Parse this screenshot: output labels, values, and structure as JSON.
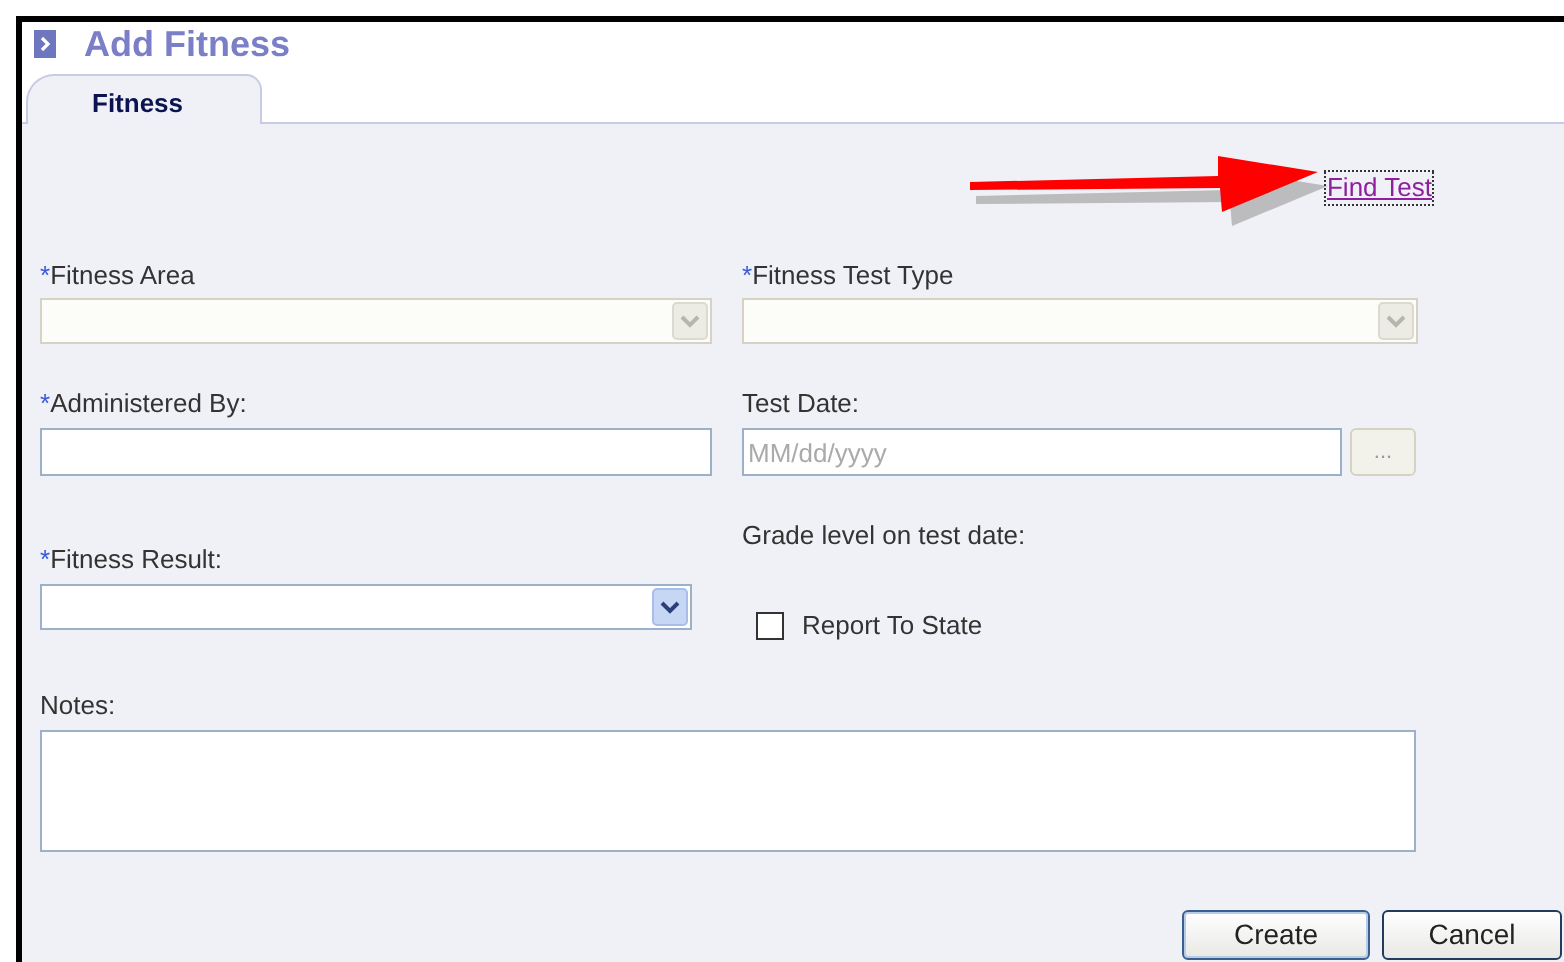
{
  "window": {
    "title": "Add Fitness"
  },
  "tabs": [
    {
      "label": "Fitness",
      "selected": true
    }
  ],
  "find_link": "Find Test",
  "fields": {
    "fitness_area": {
      "required_mark": "*",
      "label": "Fitness Area",
      "disabled": true
    },
    "fitness_test_type": {
      "required_mark": "*",
      "label": "Fitness Test Type",
      "disabled": true
    },
    "administered_by": {
      "required_mark": "*",
      "label": "Administered By:"
    },
    "test_date": {
      "label": "Test Date:",
      "placeholder": "MM/dd/yyyy",
      "picker_label": "..."
    },
    "grade_level": {
      "label": "Grade level on test date:"
    },
    "fitness_result": {
      "required_mark": "*",
      "label": "Fitness Result:",
      "disabled": false
    },
    "report_to_state": {
      "label": "Report To State",
      "checked": false
    },
    "notes": {
      "label": "Notes:"
    }
  },
  "buttons": [
    {
      "label": "Create",
      "default": true
    },
    {
      "label": "Cancel",
      "default": false
    }
  ]
}
